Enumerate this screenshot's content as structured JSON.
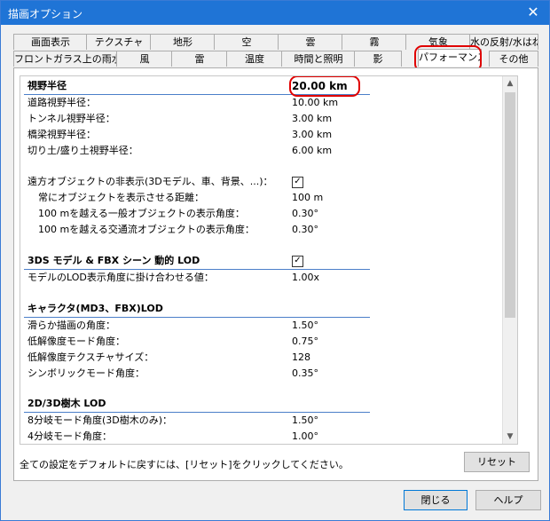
{
  "window": {
    "title": "描画オプション",
    "close_glyph": "✕"
  },
  "tabs_top": [
    "画面表示",
    "テクスチャ",
    "地形",
    "空",
    "雲",
    "霧",
    "気象",
    "水の反射/水はね"
  ],
  "tabs_bottom": [
    "フロントガラス上の雨水",
    "風",
    "雷",
    "温度",
    "時間と照明",
    "影",
    "パフォーマンス",
    "その他"
  ],
  "active_tab": "パフォーマンス",
  "settings": {
    "view_radius": {
      "label": "視野半径",
      "value": "20.00 km"
    },
    "road_radius": {
      "label": "道路視野半径：",
      "value": "10.00 km"
    },
    "tunnel_radius": {
      "label": "トンネル視野半径：",
      "value": "3.00 km"
    },
    "bridge_radius": {
      "label": "橋梁視野半径：",
      "value": "3.00 km"
    },
    "cut_radius": {
      "label": "切り土/盛り土視野半径：",
      "value": "6.00 km"
    },
    "far_hide": {
      "label": "遠方オブジェクトの非表示(3Dモデル、車、背景、...)：",
      "checked": true
    },
    "always_dist": {
      "label": "常にオブジェクトを表示させる距離：",
      "value": "100 m"
    },
    "general_angle": {
      "label": "100 mを越える一般オブジェクトの表示角度：",
      "value": "0.30°"
    },
    "traffic_angle": {
      "label": "100 mを越える交通流オブジェクトの表示角度：",
      "value": "0.30°"
    },
    "lod_section": {
      "label": "3DS モデル & FBX シーン 動的 LOD",
      "checked": true
    },
    "lod_multiplier": {
      "label": "モデルのLOD表示角度に掛け合わせる値：",
      "value": "1.00x"
    },
    "char_section": {
      "label": "キャラクタ(MD3、FBX)LOD"
    },
    "smooth_angle": {
      "label": "滑らか描画の角度：",
      "value": "1.50°"
    },
    "lowres_angle": {
      "label": "低解像度モード角度：",
      "value": "0.75°"
    },
    "lowres_tex": {
      "label": "低解像度テクスチャサイズ：",
      "value": "128"
    },
    "symbolic_angle": {
      "label": "シンボリックモード角度：",
      "value": "0.35°"
    },
    "tree_section": {
      "label": "2D/3D樹木 LOD"
    },
    "tree8_angle": {
      "label": "8分岐モード角度(3D樹木のみ)：",
      "value": "1.50°"
    },
    "tree4_angle": {
      "label": "4分岐モード角度：",
      "value": "1.00°"
    }
  },
  "footer": {
    "reset_hint": "全ての設定をデフォルトに戻すには、[リセット]をクリックしてください。",
    "reset_label": "リセット",
    "close_label": "閉じる",
    "help_label": "ヘルプ"
  },
  "colors": {
    "title_bar": "#1f74d6",
    "highlight": "#e00000",
    "section_rule": "#4b7fc9"
  }
}
